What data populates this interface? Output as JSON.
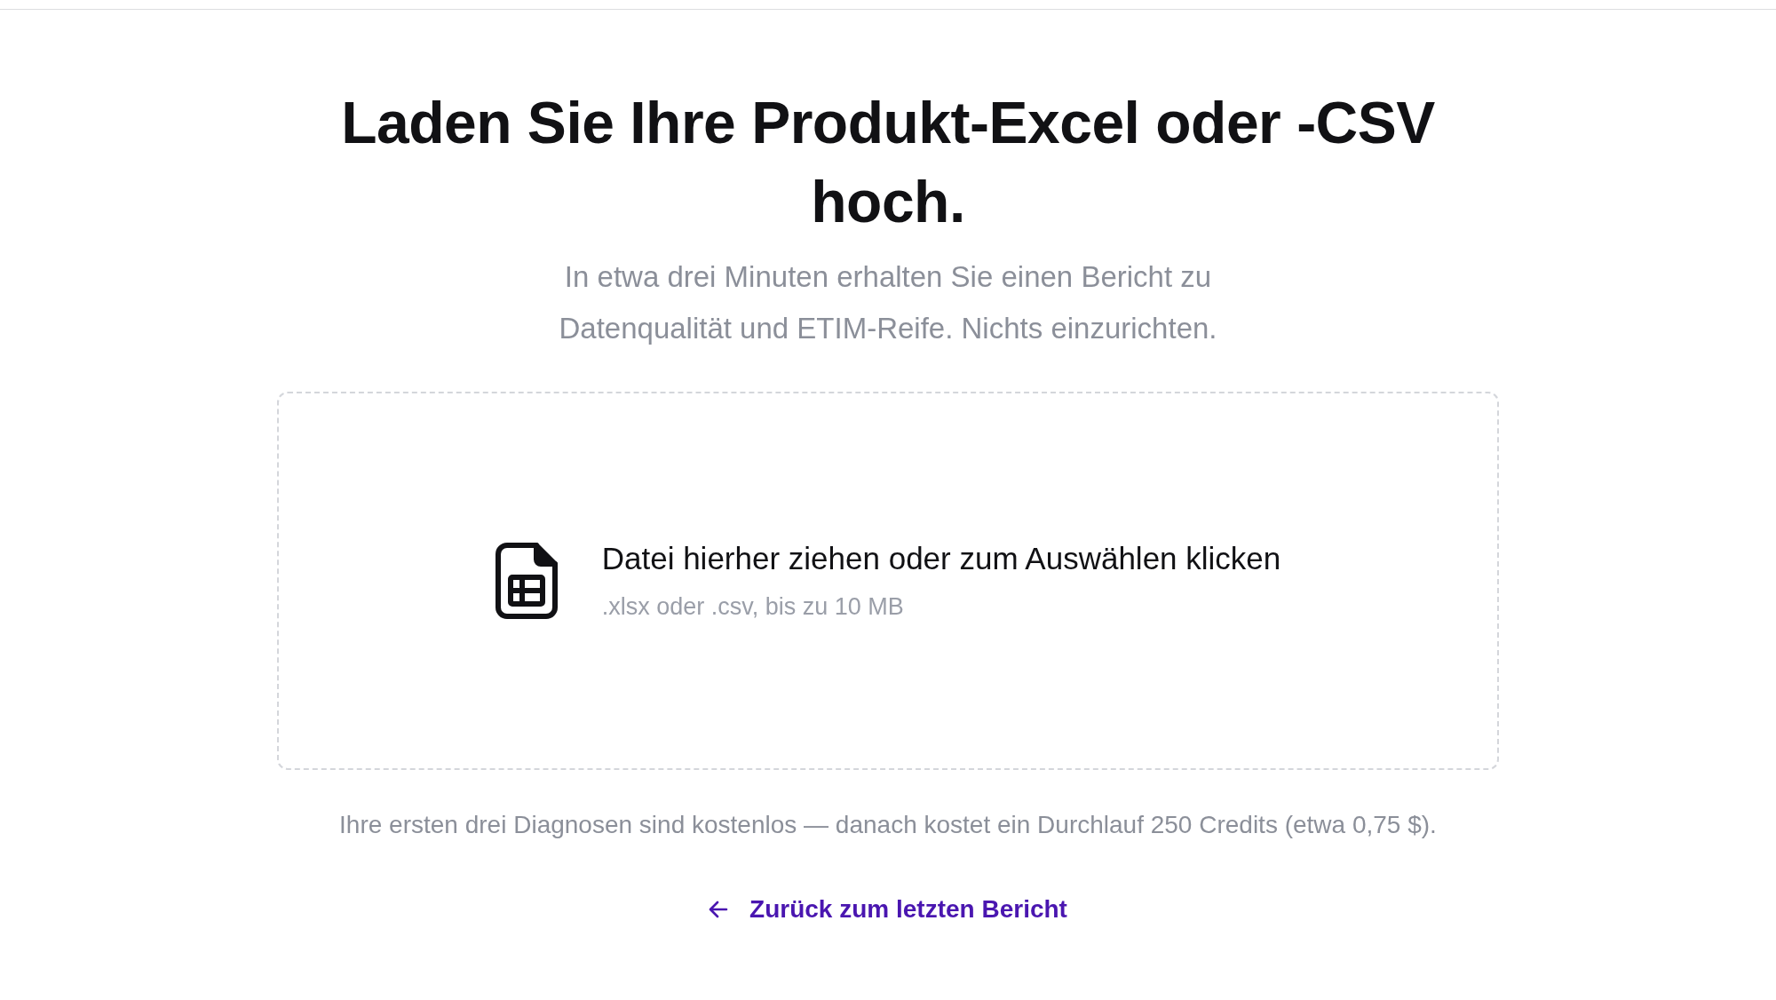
{
  "heading": "Laden Sie Ihre Produkt-Excel oder -CSV hoch.",
  "subtitle": "In etwa drei Minuten erhalten Sie einen Bericht zu Datenqualität und ETIM-Reife. Nichts einzurichten.",
  "dropzone": {
    "title": "Datei hierher ziehen oder zum Auswählen klicken",
    "hint": ".xlsx oder .csv, bis zu 10 MB"
  },
  "pricing_note": "Ihre ersten drei Diagnosen sind kostenlos — danach kostet ein Durchlauf 250 Credits (etwa 0,75 $).",
  "back_link": {
    "label": "Zurück zum letzten Bericht"
  }
}
